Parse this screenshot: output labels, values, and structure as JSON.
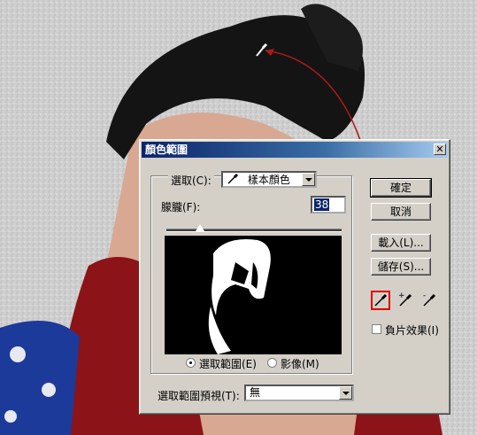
{
  "dialog": {
    "title": "顏色範圍",
    "close_label": "✕",
    "select_label": "選取(C):",
    "select_value": "樣本顏色",
    "fuzziness_label": "朦朧(F):",
    "fuzziness_value": "38",
    "radio_selection_label": "選取範圍(E)",
    "radio_image_label": "影像(M)",
    "preview_label": "選取範圍預視(T):",
    "preview_value": "無",
    "buttons": {
      "ok": "確定",
      "cancel": "取消",
      "load": "載入(L)...",
      "save": "儲存(S)..."
    },
    "invert_label": "負片效果(I)"
  },
  "icons": [
    "eyedropper-icon",
    "eyedropper-plus-icon",
    "eyedropper-minus-icon",
    "eyedropper-cursor-icon"
  ],
  "colors": {
    "dialog_bg": "#d4d0c8",
    "title_start": "#0a246a",
    "active_tool_border": "#e00000",
    "annotation_arrow": "#b01818",
    "scarf": "#8c1418",
    "jacket": "#1c3a9a"
  }
}
